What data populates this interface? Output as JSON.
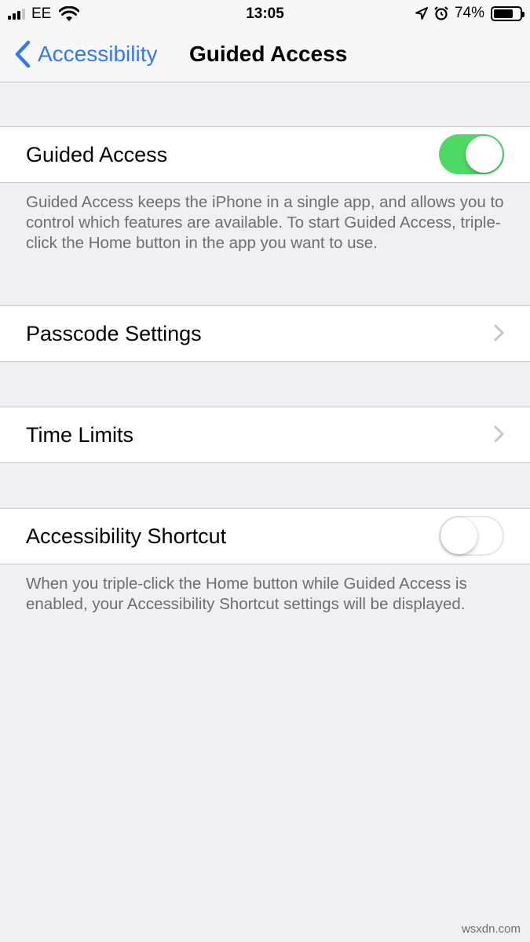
{
  "status_bar": {
    "carrier": "EE",
    "time": "13:05",
    "battery_percent": "74%",
    "battery_level": 0.74,
    "signal_bars": 3,
    "signal_total": 4
  },
  "nav": {
    "back_label": "Accessibility",
    "title": "Guided Access",
    "accent_color": "#3478f6"
  },
  "guided_access": {
    "label": "Guided Access",
    "enabled": true,
    "footer": "Guided Access keeps the iPhone in a single app, and allows you to control which features are available. To start Guided Access, triple-click the Home button in the app you want to use."
  },
  "passcode": {
    "label": "Passcode Settings"
  },
  "time_limits": {
    "label": "Time Limits"
  },
  "shortcut": {
    "label": "Accessibility Shortcut",
    "enabled": false,
    "footer": "When you triple-click the Home button while Guided Access is enabled, your Accessibility Shortcut settings will be displayed."
  },
  "watermark": "wsxdn.com"
}
